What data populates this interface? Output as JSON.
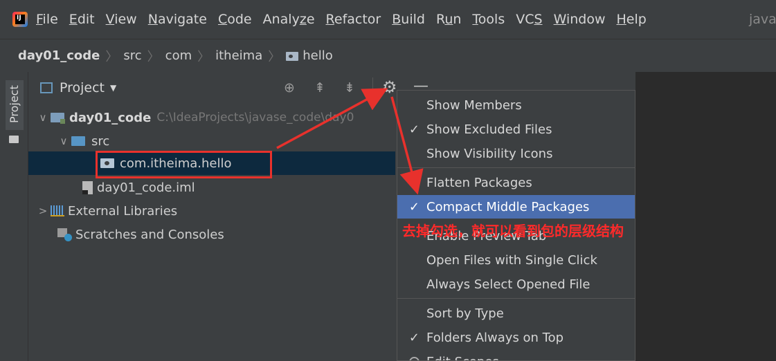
{
  "menubar": {
    "items": [
      {
        "pre": "",
        "u": "F",
        "post": "ile"
      },
      {
        "pre": "",
        "u": "E",
        "post": "dit"
      },
      {
        "pre": "",
        "u": "V",
        "post": "iew"
      },
      {
        "pre": "",
        "u": "N",
        "post": "avigate"
      },
      {
        "pre": "",
        "u": "C",
        "post": "ode"
      },
      {
        "pre": "Analy",
        "u": "z",
        "post": "e"
      },
      {
        "pre": "",
        "u": "R",
        "post": "efactor"
      },
      {
        "pre": "",
        "u": "B",
        "post": "uild"
      },
      {
        "pre": "R",
        "u": "u",
        "post": "n"
      },
      {
        "pre": "",
        "u": "T",
        "post": "ools"
      },
      {
        "pre": "VC",
        "u": "S",
        "post": ""
      },
      {
        "pre": "",
        "u": "W",
        "post": "indow"
      },
      {
        "pre": "",
        "u": "H",
        "post": "elp"
      }
    ],
    "project_name": "java"
  },
  "breadcrumb": {
    "items": [
      "day01_code",
      "src",
      "com",
      "itheima",
      "hello"
    ]
  },
  "tool_strip": {
    "project_tab": "Project"
  },
  "project_panel": {
    "title": "Project",
    "tree": {
      "root_label": "day01_code",
      "root_path": "C:\\IdeaProjects\\javase_code\\day0",
      "src_label": "src",
      "package_label": "com.itheima.hello",
      "iml_label": "day01_code.iml",
      "libs_label": "External Libraries",
      "scratches_label": "Scratches and Consoles"
    }
  },
  "popup_menu": {
    "items": [
      {
        "label": "Show Members",
        "checked": false
      },
      {
        "label": "Show Excluded Files",
        "checked": true
      },
      {
        "label": "Show Visibility Icons",
        "checked": false
      },
      {
        "label": "Flatten Packages",
        "checked": false
      },
      {
        "label": "Compact Middle Packages",
        "checked": true,
        "selected": true
      },
      {
        "label": "Enable Preview Tab",
        "checked": false
      },
      {
        "label": "Open Files with Single Click",
        "checked": false
      },
      {
        "label": "Always Select Opened File",
        "checked": false
      },
      {
        "label": "Sort by Type",
        "checked": false
      },
      {
        "label": "Folders Always on Top",
        "checked": true
      },
      {
        "label": "Edit Scopes",
        "checked": false
      }
    ],
    "check_glyph": "✓"
  },
  "annotation": {
    "text": "去掉勾选，就可以看到包的层级结构",
    "color": "#ff2a2a"
  },
  "colors": {
    "selection": "#4b6eaf",
    "tree_selection": "#0d293e",
    "annotation_red": "#e8312c"
  }
}
